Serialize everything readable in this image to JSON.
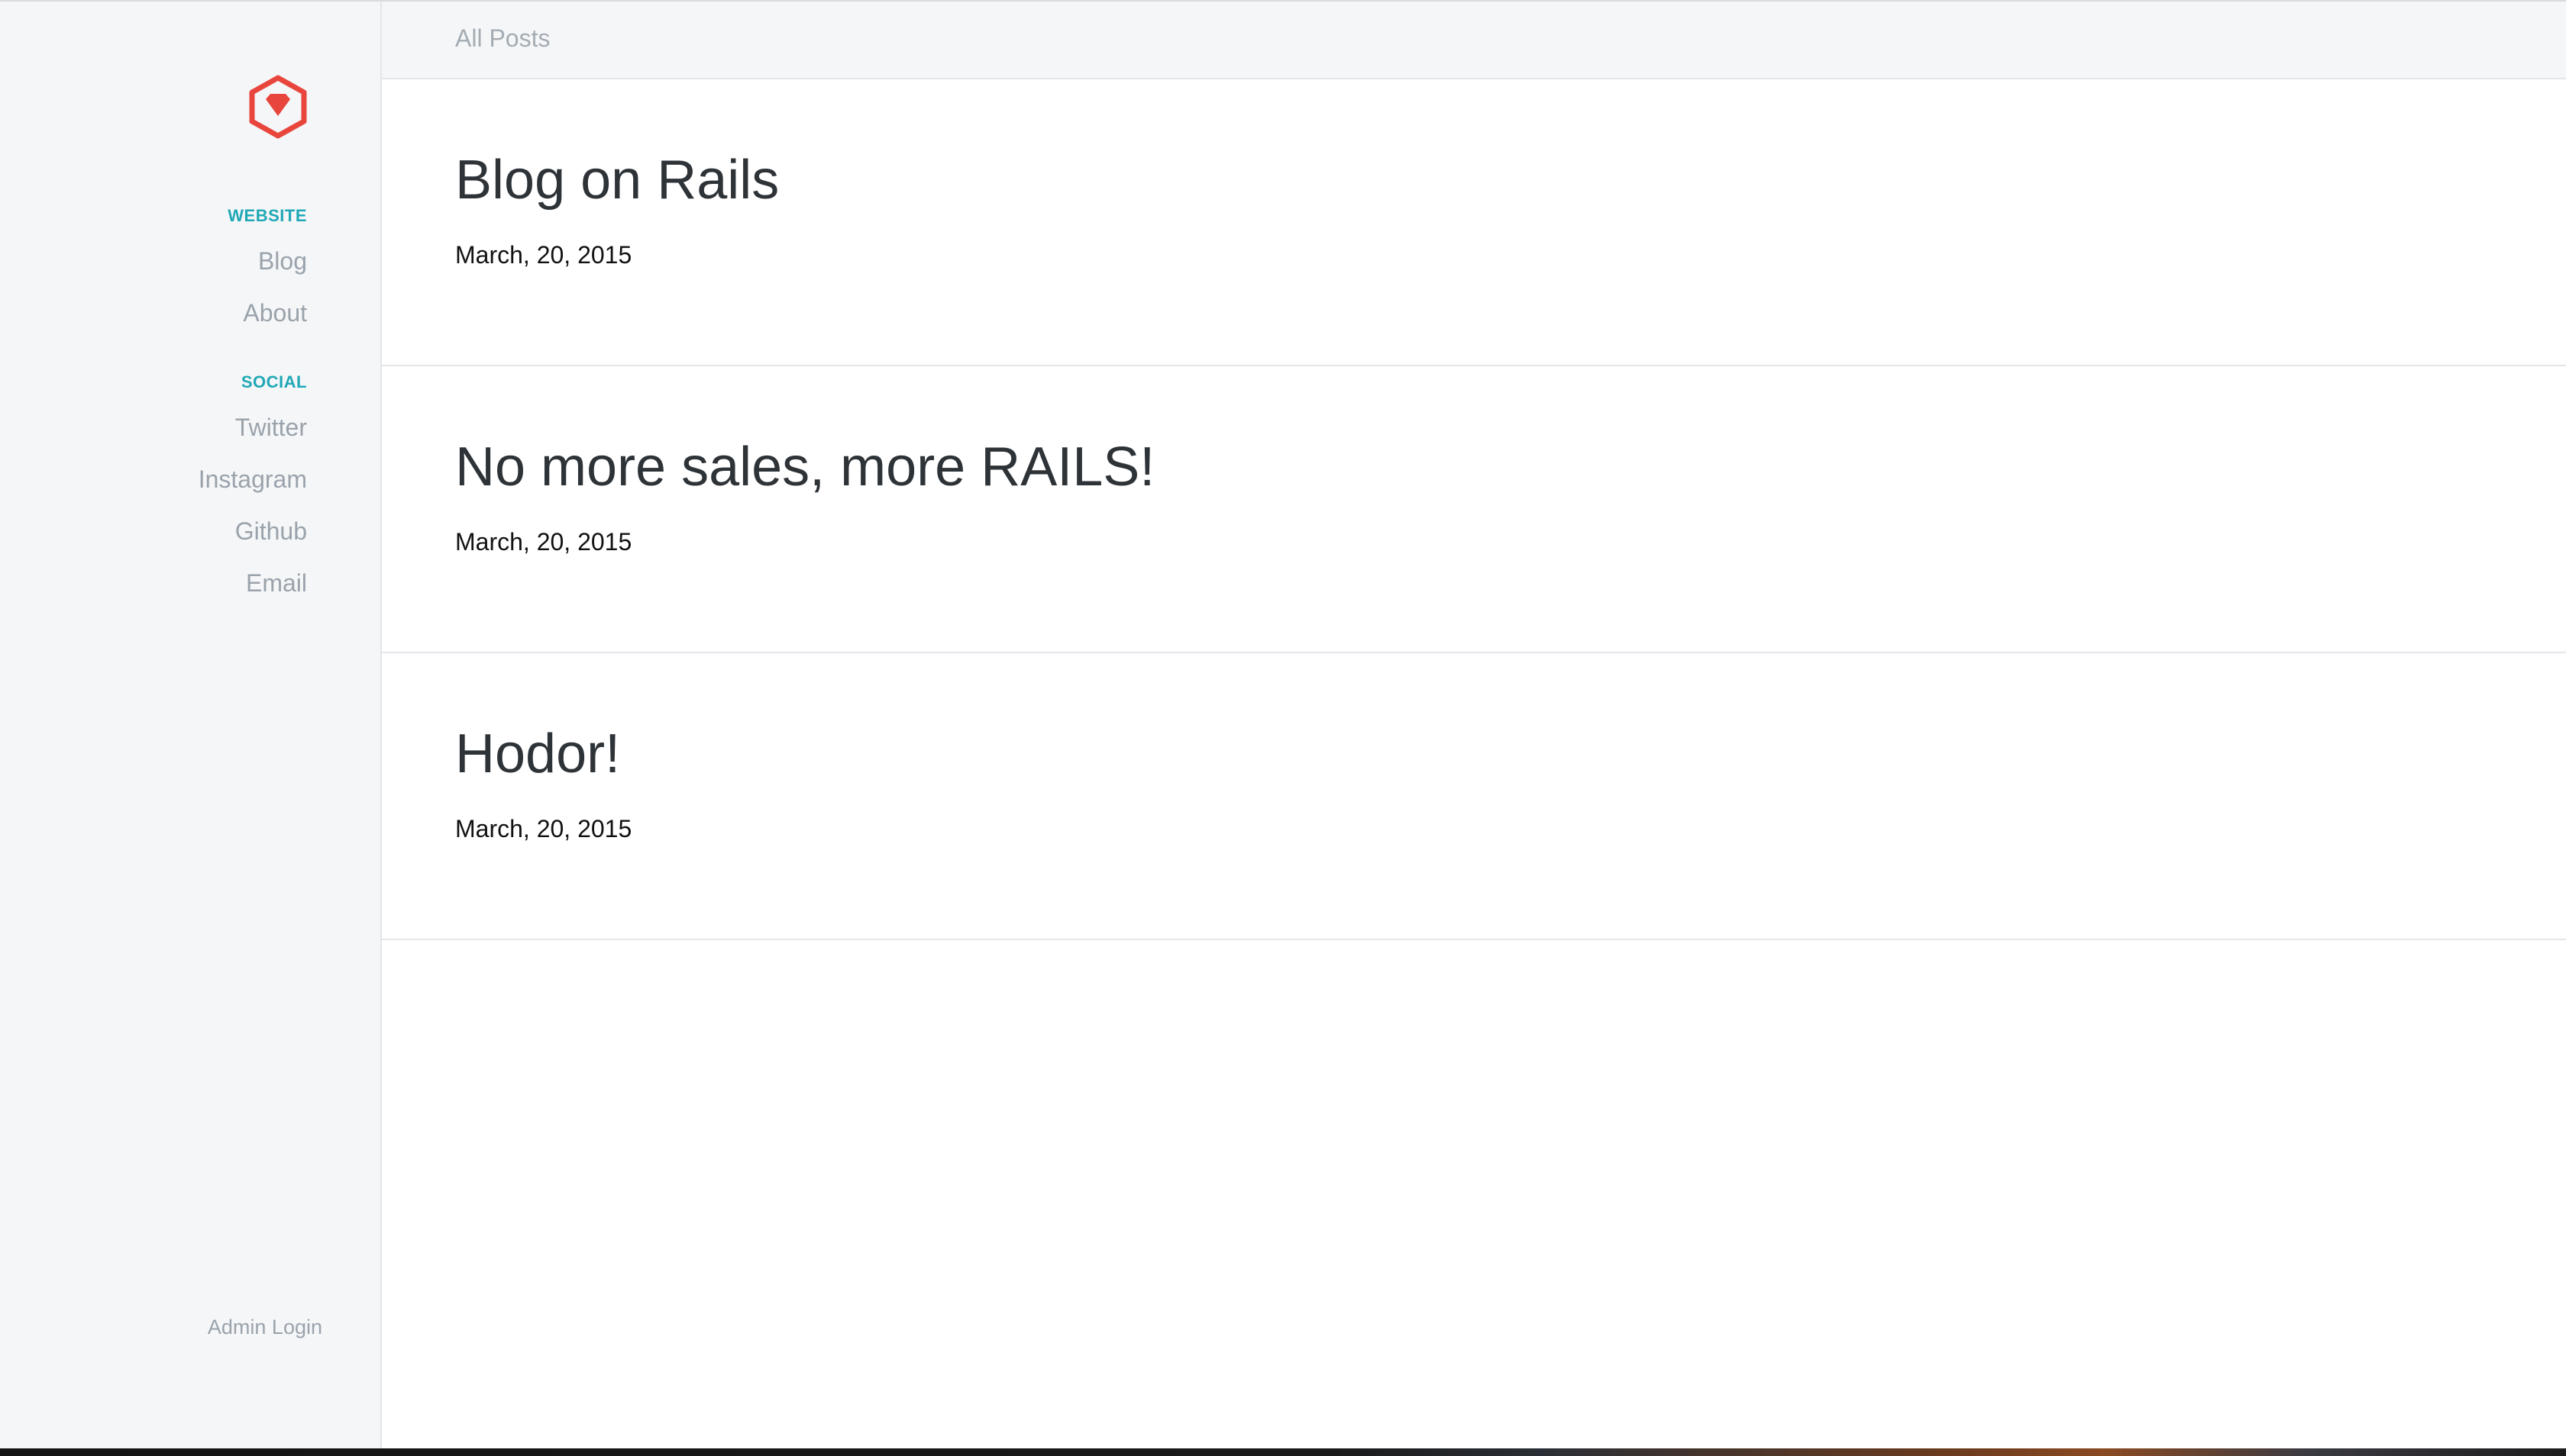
{
  "sidebar": {
    "sections": [
      {
        "heading": "WEBSITE",
        "links": [
          "Blog",
          "About"
        ]
      },
      {
        "heading": "SOCIAL",
        "links": [
          "Twitter",
          "Instagram",
          "Github",
          "Email"
        ]
      }
    ],
    "admin_login": "Admin Login",
    "logo_icon": "ruby-hexagon-icon"
  },
  "topbar": {
    "breadcrumb": "All Posts"
  },
  "posts": [
    {
      "title": "Blog on Rails",
      "date": "March, 20, 2015"
    },
    {
      "title": "No more sales, more RAILS!",
      "date": "March, 20, 2015"
    },
    {
      "title": "Hodor!",
      "date": "March, 20, 2015"
    }
  ],
  "colors": {
    "brand": "#e8453c",
    "accent": "#20a8b6",
    "muted": "#9aa3ab"
  }
}
